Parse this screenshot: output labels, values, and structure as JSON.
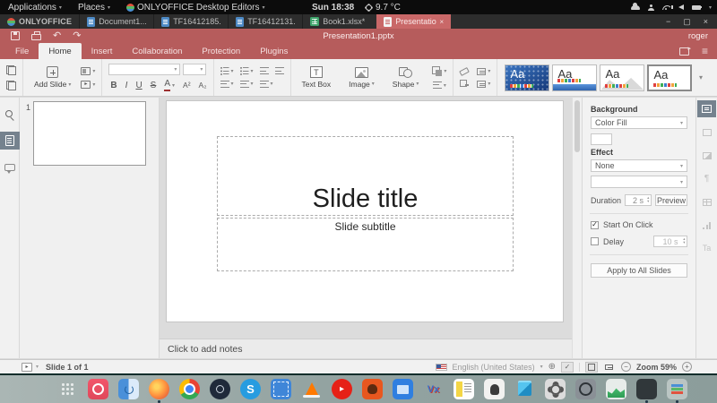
{
  "colors": {
    "titlebar_red": "#b65c5c",
    "active_tab_red": "#c96868",
    "toolbar_bg": "#f1f1f1",
    "canvas_bg": "#dcdcdc",
    "active_tile": "#75828e"
  },
  "glyphs": {
    "caret_down": "▾",
    "caret_up": "▴",
    "undo": "↶",
    "redo": "↷",
    "close": "×",
    "minimize": "−",
    "maximize": "▢",
    "hamburger": "≡",
    "play": "▸",
    "globe": "⊕",
    "check": "✓",
    "minus": "−",
    "plus": "+",
    "paragraph": "¶"
  },
  "system_bar": {
    "menus": [
      {
        "label": "Applications"
      },
      {
        "label": "Places"
      },
      {
        "label": "ONLYOFFICE Desktop Editors"
      }
    ],
    "clock": "Sun 18:38",
    "weather": "9.7 °C"
  },
  "tab_bar": {
    "app_name": "ONLYOFFICE",
    "tabs": [
      {
        "label": "Document1....",
        "type": "document"
      },
      {
        "label": "TF16412185....",
        "type": "document"
      },
      {
        "label": "TF16412131....",
        "type": "document"
      },
      {
        "label": "Book1.xlsx*",
        "type": "spreadsheet"
      },
      {
        "label": "Presentation...",
        "type": "presentation",
        "active": true
      }
    ]
  },
  "title_bar": {
    "document_title": "Presentation1.pptx",
    "user": "roger"
  },
  "menu_tabs": [
    {
      "label": "File"
    },
    {
      "label": "Home",
      "active": true
    },
    {
      "label": "Insert"
    },
    {
      "label": "Collaboration"
    },
    {
      "label": "Protection"
    },
    {
      "label": "Plugins"
    }
  ],
  "toolbar": {
    "add_slide_label": "Add Slide",
    "text_box_label": "Text Box",
    "text_box_glyph": "T",
    "image_label": "Image",
    "shape_label": "Shape",
    "format": {
      "bold": "B",
      "italic": "I",
      "underline": "U",
      "strike": "S",
      "font_color": "A",
      "superscript": "A²",
      "subscript": "A₂"
    },
    "themes": [
      {
        "label": "Aa"
      },
      {
        "label": "Aa"
      },
      {
        "label": "Aa"
      },
      {
        "label": "Aa",
        "selected": true
      }
    ]
  },
  "slide_panel": {
    "slide_number": "1"
  },
  "canvas": {
    "title_placeholder": "Slide title",
    "subtitle_placeholder": "Slide subtitle"
  },
  "notes": {
    "placeholder": "Click to add notes"
  },
  "right_panel": {
    "background_label": "Background",
    "background_fill_value": "Color Fill",
    "effect_label": "Effect",
    "effect_value": "None",
    "duration_label": "Duration",
    "duration_value": "2 s",
    "preview_label": "Preview",
    "start_on_click_label": "Start On Click",
    "start_on_click_checked": true,
    "delay_label": "Delay",
    "delay_checked": false,
    "delay_value": "10 s",
    "apply_all_label": "Apply to All Slides",
    "textart_glyph": "Ta"
  },
  "status_bar": {
    "slide_indicator": "Slide 1 of 1",
    "language": "English (United States)",
    "zoom_label": "Zoom 59%"
  },
  "dock": {
    "skype_glyph": "S",
    "youtube_glyph": "▸",
    "vx_glyph": "Vx",
    "terminal_glyph": "&gt;_"
  }
}
